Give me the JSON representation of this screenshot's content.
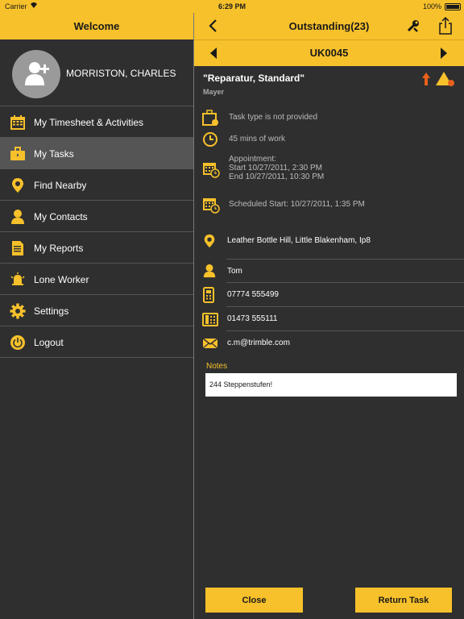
{
  "status_bar": {
    "carrier": "Carrier",
    "time": "6:29 PM",
    "battery": "100%"
  },
  "sidebar": {
    "header": "Welcome",
    "user_name": "MORRISTON, CHARLES",
    "items": [
      {
        "label": "My Timesheet & Activities",
        "icon": "calendar-icon"
      },
      {
        "label": "My Tasks",
        "icon": "briefcase-icon",
        "active": true
      },
      {
        "label": "Find Nearby",
        "icon": "location-pin-icon"
      },
      {
        "label": "My Contacts",
        "icon": "person-icon"
      },
      {
        "label": "My Reports",
        "icon": "document-icon"
      },
      {
        "label": "Lone Worker",
        "icon": "alarm-bell-icon"
      },
      {
        "label": "Settings",
        "icon": "gear-icon"
      },
      {
        "label": "Logout",
        "icon": "power-icon"
      }
    ]
  },
  "main": {
    "nav_title": "Outstanding(23)",
    "task_code": "UK0045",
    "task_title": "\"Reparatur, Standard\"",
    "task_subtitle": "Mayer",
    "task_type": "Task type is not provided",
    "duration": "45 mins of work",
    "appointment": {
      "label": "Appointment:",
      "start": "Start  10/27/2011, 2:30 PM",
      "end": "End   10/27/2011, 10:30 PM"
    },
    "scheduled_start": "Scheduled Start: 10/27/2011, 1:35 PM",
    "address": "Leather Bottle Hill, Little Blakenham, Ip8",
    "contact_name": "Tom",
    "mobile": "07774 555499",
    "phone": "01473 555111",
    "email": "c.m@trimble.com",
    "notes_label": "Notes",
    "notes_value": "244 Steppenstufen!",
    "close_label": "Close",
    "return_label": "Return Task"
  },
  "colors": {
    "accent": "#f7c12b",
    "background": "#2f2f2f",
    "active_item": "#555555",
    "priority": "#e8601c"
  }
}
